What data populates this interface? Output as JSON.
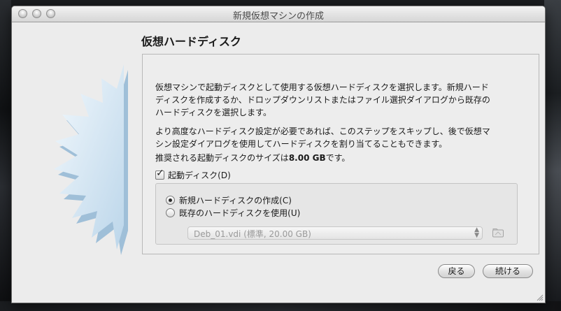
{
  "window": {
    "title": "新規仮想マシンの作成"
  },
  "page": {
    "heading": "仮想ハードディスク",
    "paragraph1_line1": "仮想マシンで起動ディスクとして使用する仮想ハードディスクを選択します。新規ハード",
    "paragraph1_line2": "ディスクを作成するか、ドロップダウンリストまたはファイル選択ダイアログから既存の",
    "paragraph1_line3": "ハードディスクを選択します。",
    "paragraph2_line1": "より高度なハードディスク設定が必要であれば、このステップをスキップし、後で仮想マ",
    "paragraph2_line2": "シン設定ダイアログを使用してハードディスクを割り当てることもできます。",
    "recommended_prefix": "推奨される起動ディスクのサイズは",
    "recommended_size": "8.00 GB",
    "recommended_suffix": "です。",
    "boot_disk_label": "起動ディスク(D)",
    "boot_disk_checked": true,
    "radio_create_label": "新規ハードディスクの作成(C)",
    "radio_existing_label": "既存のハードディスクを使用(U)",
    "selected_option": "create",
    "existing_disk_value": "Deb_01.vdi (標準, 20.00 GB)"
  },
  "buttons": {
    "back": "戻る",
    "next": "続ける"
  },
  "colors": {
    "window_bg": "#ececec",
    "starburst": "#cfe4f2",
    "disabled_text": "#9a9a9a"
  }
}
